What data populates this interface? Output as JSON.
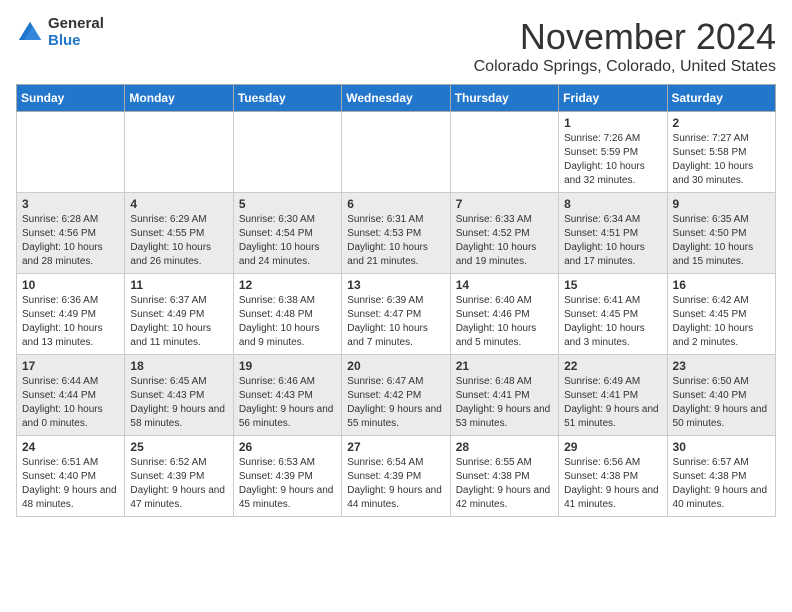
{
  "logo": {
    "general": "General",
    "blue": "Blue"
  },
  "title": "November 2024",
  "subtitle": "Colorado Springs, Colorado, United States",
  "days_of_week": [
    "Sunday",
    "Monday",
    "Tuesday",
    "Wednesday",
    "Thursday",
    "Friday",
    "Saturday"
  ],
  "weeks": [
    [
      {
        "day": "",
        "info": ""
      },
      {
        "day": "",
        "info": ""
      },
      {
        "day": "",
        "info": ""
      },
      {
        "day": "",
        "info": ""
      },
      {
        "day": "",
        "info": ""
      },
      {
        "day": "1",
        "info": "Sunrise: 7:26 AM\nSunset: 5:59 PM\nDaylight: 10 hours and 32 minutes."
      },
      {
        "day": "2",
        "info": "Sunrise: 7:27 AM\nSunset: 5:58 PM\nDaylight: 10 hours and 30 minutes."
      }
    ],
    [
      {
        "day": "3",
        "info": "Sunrise: 6:28 AM\nSunset: 4:56 PM\nDaylight: 10 hours and 28 minutes."
      },
      {
        "day": "4",
        "info": "Sunrise: 6:29 AM\nSunset: 4:55 PM\nDaylight: 10 hours and 26 minutes."
      },
      {
        "day": "5",
        "info": "Sunrise: 6:30 AM\nSunset: 4:54 PM\nDaylight: 10 hours and 24 minutes."
      },
      {
        "day": "6",
        "info": "Sunrise: 6:31 AM\nSunset: 4:53 PM\nDaylight: 10 hours and 21 minutes."
      },
      {
        "day": "7",
        "info": "Sunrise: 6:33 AM\nSunset: 4:52 PM\nDaylight: 10 hours and 19 minutes."
      },
      {
        "day": "8",
        "info": "Sunrise: 6:34 AM\nSunset: 4:51 PM\nDaylight: 10 hours and 17 minutes."
      },
      {
        "day": "9",
        "info": "Sunrise: 6:35 AM\nSunset: 4:50 PM\nDaylight: 10 hours and 15 minutes."
      }
    ],
    [
      {
        "day": "10",
        "info": "Sunrise: 6:36 AM\nSunset: 4:49 PM\nDaylight: 10 hours and 13 minutes."
      },
      {
        "day": "11",
        "info": "Sunrise: 6:37 AM\nSunset: 4:49 PM\nDaylight: 10 hours and 11 minutes."
      },
      {
        "day": "12",
        "info": "Sunrise: 6:38 AM\nSunset: 4:48 PM\nDaylight: 10 hours and 9 minutes."
      },
      {
        "day": "13",
        "info": "Sunrise: 6:39 AM\nSunset: 4:47 PM\nDaylight: 10 hours and 7 minutes."
      },
      {
        "day": "14",
        "info": "Sunrise: 6:40 AM\nSunset: 4:46 PM\nDaylight: 10 hours and 5 minutes."
      },
      {
        "day": "15",
        "info": "Sunrise: 6:41 AM\nSunset: 4:45 PM\nDaylight: 10 hours and 3 minutes."
      },
      {
        "day": "16",
        "info": "Sunrise: 6:42 AM\nSunset: 4:45 PM\nDaylight: 10 hours and 2 minutes."
      }
    ],
    [
      {
        "day": "17",
        "info": "Sunrise: 6:44 AM\nSunset: 4:44 PM\nDaylight: 10 hours and 0 minutes."
      },
      {
        "day": "18",
        "info": "Sunrise: 6:45 AM\nSunset: 4:43 PM\nDaylight: 9 hours and 58 minutes."
      },
      {
        "day": "19",
        "info": "Sunrise: 6:46 AM\nSunset: 4:43 PM\nDaylight: 9 hours and 56 minutes."
      },
      {
        "day": "20",
        "info": "Sunrise: 6:47 AM\nSunset: 4:42 PM\nDaylight: 9 hours and 55 minutes."
      },
      {
        "day": "21",
        "info": "Sunrise: 6:48 AM\nSunset: 4:41 PM\nDaylight: 9 hours and 53 minutes."
      },
      {
        "day": "22",
        "info": "Sunrise: 6:49 AM\nSunset: 4:41 PM\nDaylight: 9 hours and 51 minutes."
      },
      {
        "day": "23",
        "info": "Sunrise: 6:50 AM\nSunset: 4:40 PM\nDaylight: 9 hours and 50 minutes."
      }
    ],
    [
      {
        "day": "24",
        "info": "Sunrise: 6:51 AM\nSunset: 4:40 PM\nDaylight: 9 hours and 48 minutes."
      },
      {
        "day": "25",
        "info": "Sunrise: 6:52 AM\nSunset: 4:39 PM\nDaylight: 9 hours and 47 minutes."
      },
      {
        "day": "26",
        "info": "Sunrise: 6:53 AM\nSunset: 4:39 PM\nDaylight: 9 hours and 45 minutes."
      },
      {
        "day": "27",
        "info": "Sunrise: 6:54 AM\nSunset: 4:39 PM\nDaylight: 9 hours and 44 minutes."
      },
      {
        "day": "28",
        "info": "Sunrise: 6:55 AM\nSunset: 4:38 PM\nDaylight: 9 hours and 42 minutes."
      },
      {
        "day": "29",
        "info": "Sunrise: 6:56 AM\nSunset: 4:38 PM\nDaylight: 9 hours and 41 minutes."
      },
      {
        "day": "30",
        "info": "Sunrise: 6:57 AM\nSunset: 4:38 PM\nDaylight: 9 hours and 40 minutes."
      }
    ]
  ]
}
